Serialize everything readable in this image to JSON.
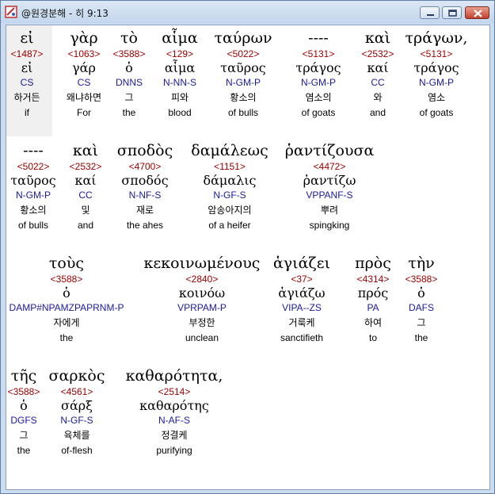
{
  "window": {
    "title": "@원경분해 - 히 9:13",
    "icon": "app-icon"
  },
  "controls": {
    "minimize": "minimize",
    "maximize": "maximize",
    "close": "close"
  },
  "rows": [
    [
      {
        "greek": "εἰ",
        "strong": "<1487>",
        "lemma": "εἰ",
        "morph": "CS",
        "korean": "하거든",
        "english": "if"
      },
      {
        "greek": "γὰρ",
        "strong": "<1063>",
        "lemma": "γάρ",
        "morph": "CS",
        "korean": "왜냐하면",
        "english": "For"
      },
      {
        "greek": "τὸ",
        "strong": "<3588>",
        "lemma": "ὁ",
        "morph": "DNNS",
        "korean": "그",
        "english": "the"
      },
      {
        "greek": "αἷμα",
        "strong": "<129>",
        "lemma": "αἷμα",
        "morph": "N-NN-S",
        "korean": "피와",
        "english": "blood"
      },
      {
        "greek": "ταύρων",
        "strong": "<5022>",
        "lemma": "ταῦρος",
        "morph": "N-GM-P",
        "korean": "황소의",
        "english": "of bulls"
      },
      {
        "greek": "----",
        "strong": "<5131>",
        "lemma": "τράγος",
        "morph": "N-GM-P",
        "korean": "염소의",
        "english": "of goats"
      },
      {
        "greek": "καὶ",
        "strong": "<2532>",
        "lemma": "καί",
        "morph": "CC",
        "korean": "와",
        "english": "and"
      },
      {
        "greek": "τράγων,",
        "strong": "<5131>",
        "lemma": "τράγος",
        "morph": "N-GM-P",
        "korean": "염소",
        "english": "of goats"
      }
    ],
    [
      {
        "greek": "----",
        "strong": "<5022>",
        "lemma": "ταῦρος",
        "morph": "N-GM-P",
        "korean": "황소의",
        "english": "of bulls"
      },
      {
        "greek": "καὶ",
        "strong": "<2532>",
        "lemma": "καί",
        "morph": "CC",
        "korean": "및",
        "english": "and"
      },
      {
        "greek": "σποδὸς",
        "strong": "<4700>",
        "lemma": "σποδός",
        "morph": "N-NF-S",
        "korean": "재로",
        "english": "the ahes"
      },
      {
        "greek": "δαμάλεως",
        "strong": "<1151>",
        "lemma": "δάμαλις",
        "morph": "N-GF-S",
        "korean": "암송아지의",
        "english": "of a heifer"
      },
      {
        "greek": "ῥαντίζουσα",
        "strong": "<4472>",
        "lemma": "ῥαντίζω",
        "morph": "VPPANF-S",
        "korean": "뿌려",
        "english": "spingking"
      }
    ],
    [
      {
        "greek": "τοὺς",
        "strong": "<3588>",
        "lemma": "ὁ",
        "morph": "DAMP#NPAMZPAPRNM-P",
        "korean": "자에게",
        "english": "the"
      },
      {
        "greek": "κεκοινωμένους",
        "strong": "<2840>",
        "lemma": "κοινόω",
        "morph": "VPRPAM-P",
        "korean": "부정한",
        "english": "unclean"
      },
      {
        "greek": "ἁγιάζει",
        "strong": "<37>",
        "lemma": "ἁγιάζω",
        "morph": "VIPA--ZS",
        "korean": "거룩케",
        "english": "sanctifieth"
      },
      {
        "greek": "πρὸς",
        "strong": "<4314>",
        "lemma": "πρός",
        "morph": "PA",
        "korean": "하여",
        "english": "to"
      },
      {
        "greek": "τὴν",
        "strong": "<3588>",
        "lemma": "ὁ",
        "morph": "DAFS",
        "korean": "그",
        "english": "the"
      }
    ],
    [
      {
        "greek": "τῆς",
        "strong": "<3588>",
        "lemma": "ὁ",
        "morph": "DGFS",
        "korean": "그",
        "english": "the"
      },
      {
        "greek": "σαρκὸς",
        "strong": "<4561>",
        "lemma": "σάρξ",
        "morph": "N-GF-S",
        "korean": "육체를",
        "english": "of-flesh"
      },
      {
        "greek": "καθαρότητα,",
        "strong": "<2514>",
        "lemma": "καθαρότης",
        "morph": "N-AF-S",
        "korean": "정결케",
        "english": "purifying"
      }
    ]
  ]
}
